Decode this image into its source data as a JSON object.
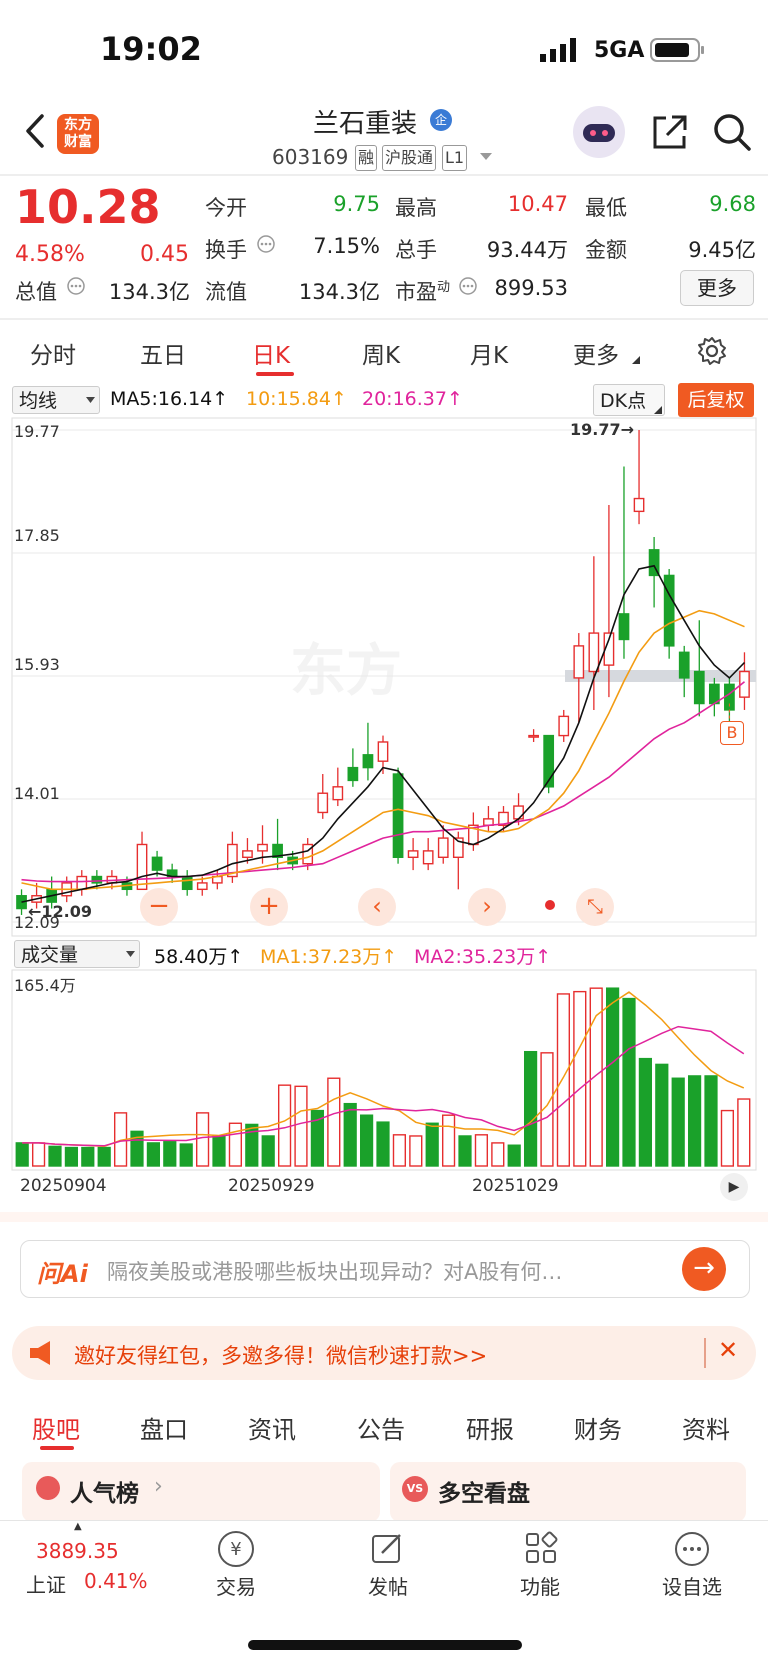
{
  "status_bar": {
    "time": "19:02",
    "network": "5GA"
  },
  "header": {
    "name": "兰石重装",
    "badge": "企",
    "code": "603169",
    "tags": [
      "融",
      "沪股通",
      "L1"
    ],
    "logo_text": [
      "东方",
      "财富"
    ]
  },
  "quote": {
    "price": "10.28",
    "change_pct": "4.58%",
    "change": "0.45",
    "rows": [
      [
        {
          "label": "今开",
          "value": "9.75"
        },
        {
          "label": "最高",
          "value": "10.47"
        },
        {
          "label": "最低",
          "value": "9.68"
        }
      ],
      [
        {
          "label": "换手",
          "value": "7.15%"
        },
        {
          "label": "总手",
          "value": "93.44万"
        },
        {
          "label": "金额",
          "value": "9.45亿"
        }
      ]
    ],
    "total_value_label": "总值",
    "total_value": "134.3亿",
    "float_value_label": "流值",
    "float_value": "134.3亿",
    "pe_label": "市盈",
    "pe_sup": "动",
    "pe": "899.53",
    "more": "更多"
  },
  "period_tabs": {
    "items": [
      "分时",
      "五日",
      "日K",
      "周K",
      "月K",
      "更多"
    ],
    "active": 2
  },
  "ma_bar": {
    "selector": "均线",
    "ma5": "MA5:16.14",
    "ma10": "10:15.84",
    "ma20": "20:16.37",
    "dk": "DK点",
    "adjust": "后复权"
  },
  "colors": {
    "up": "#e62e2e",
    "down": "#1aa12a",
    "ma5": "#111111",
    "ma10": "#f39c12",
    "ma20": "#e0249c",
    "accent": "#f05a22"
  },
  "chart_data": [
    {
      "type": "candlestick",
      "ylim": [
        12.09,
        19.77
      ],
      "y_ticks": [
        "19.77",
        "17.85",
        "15.93",
        "14.01",
        "12.09"
      ],
      "high_label": "19.77",
      "low_label": "12.09",
      "marker": "B",
      "candles": [
        [
          12.5,
          12.3,
          12.6,
          12.2
        ],
        [
          12.4,
          12.5,
          12.7,
          12.3
        ],
        [
          12.6,
          12.4,
          12.8,
          12.3
        ],
        [
          12.5,
          12.7,
          12.8,
          12.4
        ],
        [
          12.6,
          12.8,
          12.9,
          12.5
        ],
        [
          12.8,
          12.7,
          12.9,
          12.6
        ],
        [
          12.7,
          12.8,
          12.9,
          12.6
        ],
        [
          12.7,
          12.6,
          12.8,
          12.5
        ],
        [
          12.6,
          13.3,
          13.5,
          12.6
        ],
        [
          13.1,
          12.9,
          13.2,
          12.8
        ],
        [
          12.9,
          12.8,
          13.0,
          12.7
        ],
        [
          12.8,
          12.6,
          12.9,
          12.5
        ],
        [
          12.6,
          12.7,
          12.8,
          12.5
        ],
        [
          12.7,
          12.8,
          12.9,
          12.6
        ],
        [
          12.8,
          13.3,
          13.5,
          12.7
        ],
        [
          13.1,
          13.2,
          13.4,
          13.0
        ],
        [
          13.2,
          13.3,
          13.6,
          13.0
        ],
        [
          13.3,
          13.1,
          13.7,
          12.9
        ],
        [
          13.1,
          13.0,
          13.2,
          12.9
        ],
        [
          13.0,
          13.3,
          13.4,
          12.9
        ],
        [
          13.8,
          14.1,
          14.4,
          13.7
        ],
        [
          14.0,
          14.2,
          14.5,
          13.9
        ],
        [
          14.5,
          14.3,
          14.8,
          14.2
        ],
        [
          14.7,
          14.5,
          15.2,
          14.3
        ],
        [
          14.6,
          14.9,
          15.0,
          14.4
        ],
        [
          14.4,
          13.1,
          14.5,
          13.0
        ],
        [
          13.1,
          13.2,
          13.4,
          12.9
        ],
        [
          13.0,
          13.2,
          13.4,
          12.9
        ],
        [
          13.1,
          13.4,
          13.6,
          13.0
        ],
        [
          13.1,
          13.4,
          13.5,
          12.6
        ],
        [
          13.3,
          13.6,
          13.8,
          13.2
        ],
        [
          13.6,
          13.7,
          13.9,
          13.5
        ],
        [
          13.6,
          13.8,
          13.9,
          13.5
        ],
        [
          13.7,
          13.9,
          14.1,
          13.6
        ],
        [
          15.0,
          15.0,
          15.1,
          14.9
        ],
        [
          15.0,
          14.2,
          15.0,
          14.1
        ],
        [
          15.0,
          15.3,
          15.4,
          14.9
        ],
        [
          15.9,
          16.4,
          16.6,
          15.2
        ],
        [
          16.0,
          16.6,
          17.8,
          15.4
        ],
        [
          16.1,
          16.6,
          18.6,
          15.6
        ],
        [
          16.9,
          16.5,
          19.2,
          16.2
        ],
        [
          18.5,
          18.7,
          19.77,
          18.3
        ],
        [
          17.9,
          17.5,
          18.1,
          17.0
        ],
        [
          17.5,
          16.4,
          17.6,
          16.2
        ],
        [
          16.3,
          15.9,
          16.4,
          15.6
        ],
        [
          16.0,
          15.5,
          16.8,
          15.3
        ],
        [
          15.8,
          15.5,
          15.9,
          15.3
        ],
        [
          15.8,
          15.4,
          15.9,
          15.2
        ],
        [
          15.6,
          16.0,
          16.3,
          15.4
        ]
      ],
      "ma5": [
        12.4,
        12.45,
        12.5,
        12.55,
        12.6,
        12.65,
        12.7,
        12.72,
        12.8,
        12.85,
        12.8,
        12.8,
        12.82,
        12.9,
        13.0,
        13.05,
        13.1,
        13.12,
        13.15,
        13.2,
        13.4,
        13.7,
        13.95,
        14.2,
        14.5,
        14.45,
        14.15,
        13.85,
        13.55,
        13.35,
        13.3,
        13.4,
        13.55,
        13.7,
        13.95,
        14.3,
        14.65,
        15.2,
        15.9,
        16.5,
        17.2,
        17.6,
        17.65,
        17.2,
        16.8,
        16.4,
        16.1,
        15.9,
        16.14
      ],
      "ma10": [
        12.7,
        12.65,
        12.6,
        12.6,
        12.6,
        12.62,
        12.64,
        12.66,
        12.68,
        12.7,
        12.72,
        12.74,
        12.76,
        12.8,
        12.85,
        12.9,
        12.95,
        13.0,
        13.05,
        13.1,
        13.2,
        13.35,
        13.5,
        13.65,
        13.8,
        13.85,
        13.8,
        13.75,
        13.65,
        13.6,
        13.55,
        13.5,
        13.5,
        13.55,
        13.7,
        13.85,
        14.1,
        14.45,
        14.9,
        15.35,
        15.85,
        16.3,
        16.6,
        16.75,
        16.85,
        16.95,
        16.9,
        16.8,
        16.7
      ],
      "ma20": [
        12.75,
        12.73,
        12.72,
        12.72,
        12.72,
        12.73,
        12.74,
        12.75,
        12.76,
        12.77,
        12.78,
        12.8,
        12.82,
        12.84,
        12.86,
        12.88,
        12.9,
        12.92,
        12.94,
        12.97,
        13.0,
        13.1,
        13.2,
        13.3,
        13.4,
        13.45,
        13.5,
        13.5,
        13.52,
        13.54,
        13.56,
        13.6,
        13.62,
        13.66,
        13.7,
        13.8,
        13.9,
        14.05,
        14.2,
        14.35,
        14.55,
        14.75,
        14.95,
        15.1,
        15.2,
        15.35,
        15.5,
        15.65,
        15.84
      ]
    },
    {
      "type": "bar",
      "title": "成交量",
      "summary": "58.40万",
      "ma1": "MA1:37.23万",
      "ma2": "MA2:35.23万",
      "ymax_label": "165.4万",
      "ylim": [
        0,
        165.4
      ],
      "x_labels": [
        "20250904",
        "20250929",
        "20251029"
      ],
      "values": [
        20,
        20,
        17,
        16,
        16,
        16,
        46,
        30,
        20,
        21,
        19,
        46,
        26,
        37,
        36,
        26,
        70,
        69,
        48,
        76,
        54,
        44,
        38,
        27,
        26,
        37,
        44,
        26,
        27,
        20,
        18,
        99,
        98,
        149,
        151,
        154,
        154,
        145,
        93,
        88,
        76,
        78,
        78,
        48,
        58
      ],
      "up": [
        0,
        1,
        0,
        0,
        0,
        0,
        1,
        0,
        0,
        0,
        0,
        1,
        0,
        1,
        0,
        0,
        1,
        1,
        0,
        1,
        0,
        0,
        0,
        1,
        1,
        0,
        1,
        0,
        1,
        1,
        0,
        0,
        1,
        1,
        1,
        1,
        0,
        0,
        0,
        0,
        0,
        0,
        0,
        1,
        1
      ]
    }
  ],
  "ask_ai": {
    "brand": "问Ai",
    "placeholder": "隔夜美股或港股哪些板块出现异动？对A股有何…"
  },
  "invite_banner": {
    "text": "邀好友得红包，多邀多得！微信秒速打款>>"
  },
  "bottom_tabs": {
    "items": [
      "股吧",
      "盘口",
      "资讯",
      "公告",
      "研报",
      "财务",
      "资料"
    ],
    "active": 0
  },
  "cards": {
    "left": "人气榜",
    "right": "多空看盘",
    "right_badge": "VS"
  },
  "bottom_nav": {
    "index_value": "3889.35",
    "index_name": "上证",
    "index_change": "0.41%",
    "items": [
      "交易",
      "发帖",
      "功能",
      "设自选"
    ]
  }
}
